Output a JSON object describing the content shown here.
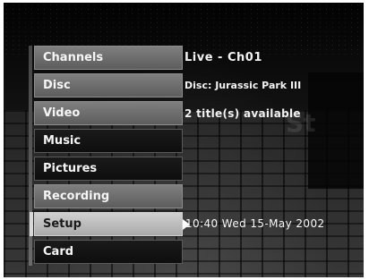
{
  "menu": {
    "items": [
      {
        "label": "Channels"
      },
      {
        "label": "Disc"
      },
      {
        "label": "Video"
      },
      {
        "label": "Music"
      },
      {
        "label": "Pictures"
      },
      {
        "label": "Recording"
      },
      {
        "label": "Setup"
      },
      {
        "label": "Card"
      }
    ],
    "selected": "Setup"
  },
  "info": {
    "live": "Live - Ch01",
    "disc": "Disc: Jurassic Park III",
    "titles": "2 title(s) available",
    "clock": "10:40 Wed 15-May 2002"
  },
  "background_text": "St"
}
